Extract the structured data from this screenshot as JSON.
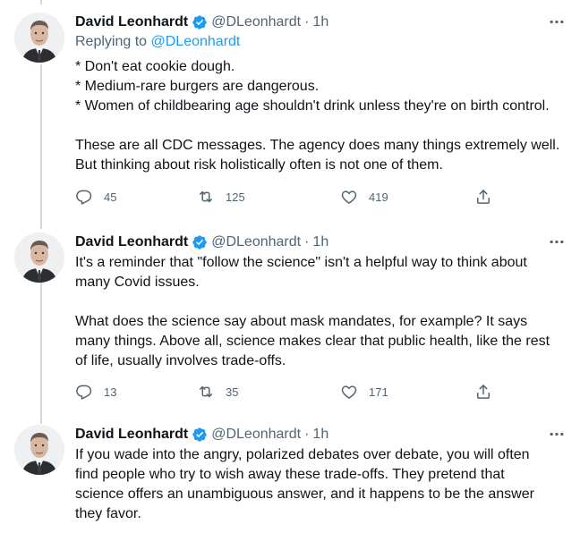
{
  "tweets": [
    {
      "author": "David Leonhardt",
      "handle": "@DLeonhardt",
      "separator": "·",
      "time": "1h",
      "reply_prefix": "Replying to",
      "reply_to": "@DLeonhardt",
      "lines": [
        "* Don't eat cookie dough.",
        "* Medium-rare burgers are dangerous.",
        "* Women of childbearing age shouldn't drink unless they're on birth control.",
        "These are all CDC messages. The agency does many things extremely well.",
        "But thinking about risk holistically often is not one of them."
      ],
      "replies": "45",
      "retweets": "125",
      "likes": "419"
    },
    {
      "author": "David Leonhardt",
      "handle": "@DLeonhardt",
      "separator": "·",
      "time": "1h",
      "lines": [
        "It's a reminder that \"follow the science\" isn't a helpful way to think about",
        "many Covid issues.",
        "What does the science say about mask mandates, for example? It says",
        "many things. Above all, science makes clear that public health, like the rest",
        "of life, usually involves trade-offs."
      ],
      "replies": "13",
      "retweets": "35",
      "likes": "171"
    },
    {
      "author": "David Leonhardt",
      "handle": "@DLeonhardt",
      "separator": "·",
      "time": "1h",
      "lines": [
        "If you wade into the angry, polarized debates over debate, you will often",
        "find people who try to wish away these trade-offs. They pretend that",
        "science offers an unambiguous answer, and it happens to be the answer",
        "they favor."
      ]
    }
  ],
  "colors": {
    "text": "#0f1419",
    "secondary": "#536471",
    "link": "#1d9bf0",
    "verified": "#1d9bf0",
    "thread_line": "#cfd9de"
  },
  "icons": [
    "avatar",
    "verified-badge-icon",
    "more-icon",
    "reply-icon",
    "retweet-icon",
    "like-icon",
    "share-icon"
  ]
}
